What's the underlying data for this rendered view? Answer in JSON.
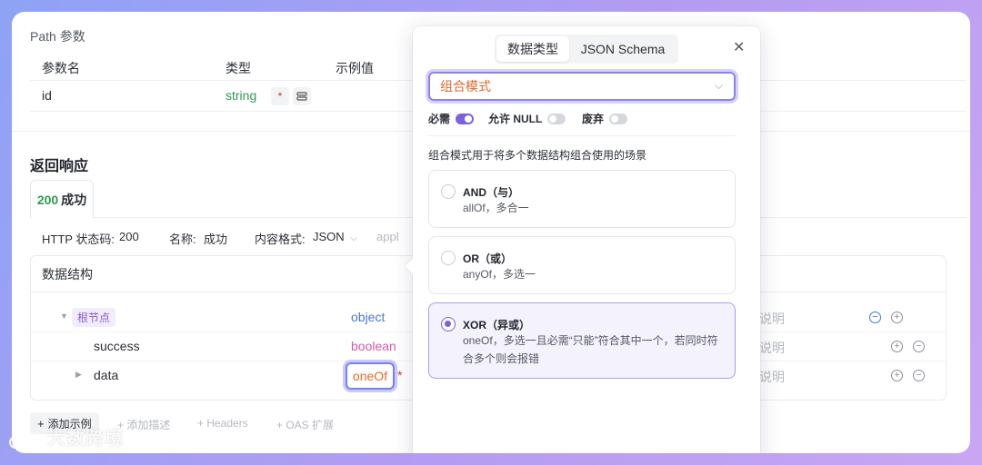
{
  "path_params": {
    "title": "Path 参数",
    "columns": [
      "参数名",
      "类型",
      "示例值"
    ],
    "row": {
      "name": "id",
      "type": "string",
      "required_mark": "*"
    }
  },
  "response": {
    "title": "返回响应",
    "tab_code": "200",
    "tab_label": "成功",
    "meta": {
      "http_code_label": "HTTP 状态码:",
      "http_code": "200",
      "name_label": "名称:",
      "name": "成功",
      "format_label": "内容格式:",
      "format": "JSON",
      "format_extra": "appl"
    },
    "ds_title": "数据结构",
    "rows": [
      {
        "name": "根节点",
        "type": "object",
        "desc_placeholder": "说明"
      },
      {
        "name": "success",
        "type": "boolean",
        "desc_placeholder": "说明"
      },
      {
        "name": "data",
        "type": "oneOf",
        "required_mark": "*",
        "desc_placeholder": "说明"
      }
    ],
    "actions": {
      "add_example": "添加示例",
      "add_desc": "添加描述",
      "headers": "Headers",
      "oas": "OAS 扩展"
    }
  },
  "popover": {
    "tabs": [
      "数据类型",
      "JSON Schema"
    ],
    "active_tab": "数据类型",
    "close": "✕",
    "select_value": "组合模式",
    "toggles": [
      {
        "label": "必需",
        "on": true
      },
      {
        "label": "允许 NULL",
        "on": false
      },
      {
        "label": "废弃",
        "on": false
      }
    ],
    "description": "组合模式用于将多个数据结构组合使用的场景",
    "options": [
      {
        "title": "AND（与）",
        "subtitle": "allOf，多合一",
        "selected": false
      },
      {
        "title": "OR（或）",
        "subtitle": "anyOf，多选一",
        "selected": false
      },
      {
        "title": "XOR（异或）",
        "subtitle": "oneOf，多选一且必需“只能”符合其中一个，若同时符合多个则会报错",
        "selected": true
      }
    ]
  },
  "watermark": "大数跨境",
  "colors": {
    "accent": "#7a5fe0",
    "success_green": "#2a9d52",
    "orange_value": "#e06a2a",
    "object_blue": "#4a78d8",
    "boolean_pink": "#d85aa8"
  }
}
